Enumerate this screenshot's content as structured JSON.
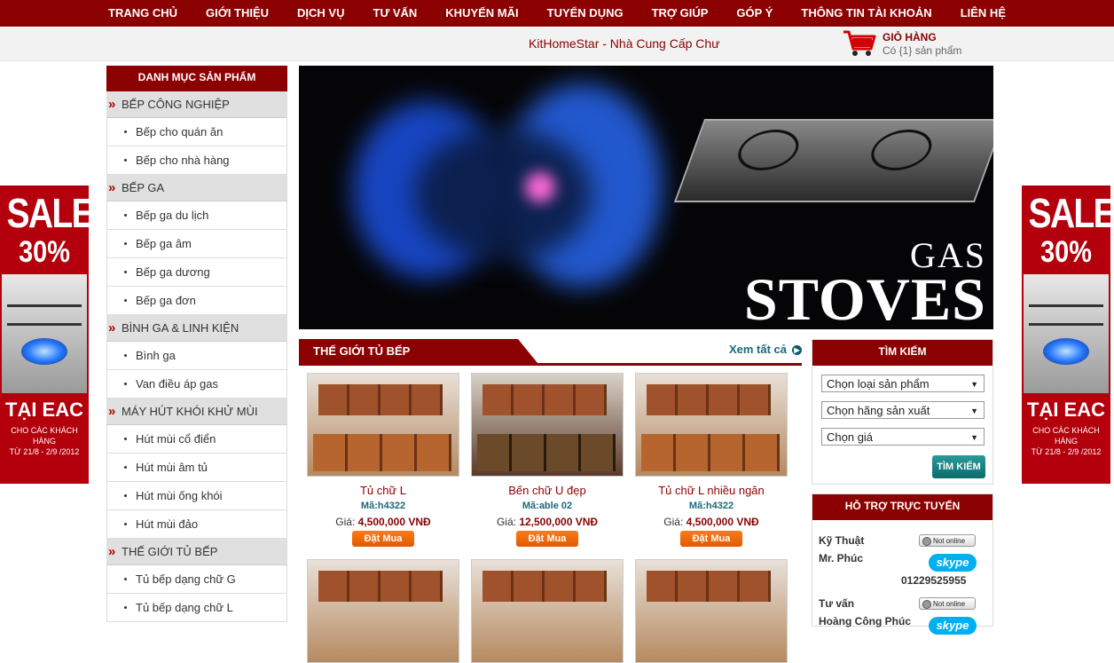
{
  "nav": [
    "TRANG CHỦ",
    "GIỚI THIỆU",
    "DỊCH VỤ",
    "TƯ VẤN",
    "KHUYẾN MÃI",
    "TUYỂN DỤNG",
    "TRỢ GIÚP",
    "GÓP Ý",
    "THÔNG TIN TÀI KHOẢN",
    "LIÊN HỆ"
  ],
  "header": {
    "tagline": "KitHomeStar - Nhà Cung Cấp Chư",
    "cart_title": "GIỎ HÀNG",
    "cart_count": "Có {1} sản phẩm"
  },
  "sale_banner": {
    "word": "SALE",
    "percent": "30%",
    "place": "TẠI EAC",
    "line1": "CHO CÁC KHÁCH HÀNG",
    "line2": "TỪ 21/8 - 2/9 /2012"
  },
  "left_menu": {
    "title": "DANH MỤC SẢN PHẨM",
    "categories": [
      {
        "name": "BẾP CÔNG NGHIỆP",
        "items": [
          "Bếp cho quán ăn",
          "Bếp cho nhà hàng"
        ]
      },
      {
        "name": "BẾP GA",
        "items": [
          "Bếp ga du lịch",
          "Bếp ga âm",
          "Bếp ga dương",
          "Bếp ga đơn"
        ]
      },
      {
        "name": "BÌNH GA & LINH KIỆN",
        "items": [
          "Bình ga",
          "Van điều áp gas"
        ]
      },
      {
        "name": "MÁY HÚT KHÓI KHỬ MÙI",
        "items": [
          "Hút mùi cổ điển",
          "Hút mùi âm tủ",
          "Hút mùi ống khói",
          "Hút mùi đảo"
        ]
      },
      {
        "name": "THẾ GIỚI TỦ BẾP",
        "items": [
          "Tủ bếp dạng chữ G",
          "Tủ bếp dạng chữ L"
        ]
      }
    ]
  },
  "hero": {
    "line1": "GAS",
    "line2": "STOVES"
  },
  "products_section": {
    "title": "THẾ GIỚI TỦ BẾP",
    "view_all": "Xem tất cả",
    "price_label": "Giá:",
    "buy_label": "Đặt Mua",
    "products": [
      {
        "name": "Tủ chữ L",
        "code": "Mã:h4322",
        "price": "4,500,000 VNĐ"
      },
      {
        "name": "Bến chữ U đẹp",
        "code": "Mã:able 02",
        "price": "12,500,000 VNĐ"
      },
      {
        "name": "Tủ chữ L nhiều ngăn",
        "code": "Mã:h4322",
        "price": "4,500,000 VNĐ"
      }
    ]
  },
  "search": {
    "title": "TÌM KIẾM",
    "selects": [
      "Chọn loại sản phẩm",
      "Chọn hãng sản xuất",
      "Chọn giá"
    ],
    "button": "TÌM KIẾM"
  },
  "support": {
    "title": "HỖ TRỢ TRỰC TUYẾN",
    "status": "Not online",
    "skype": "skype",
    "contacts": [
      {
        "role": "Kỹ Thuật",
        "name": "Mr. Phúc",
        "phone": "01229525955"
      },
      {
        "role": "Tư vấn",
        "name": "Hoàng Công Phúc"
      }
    ]
  }
}
